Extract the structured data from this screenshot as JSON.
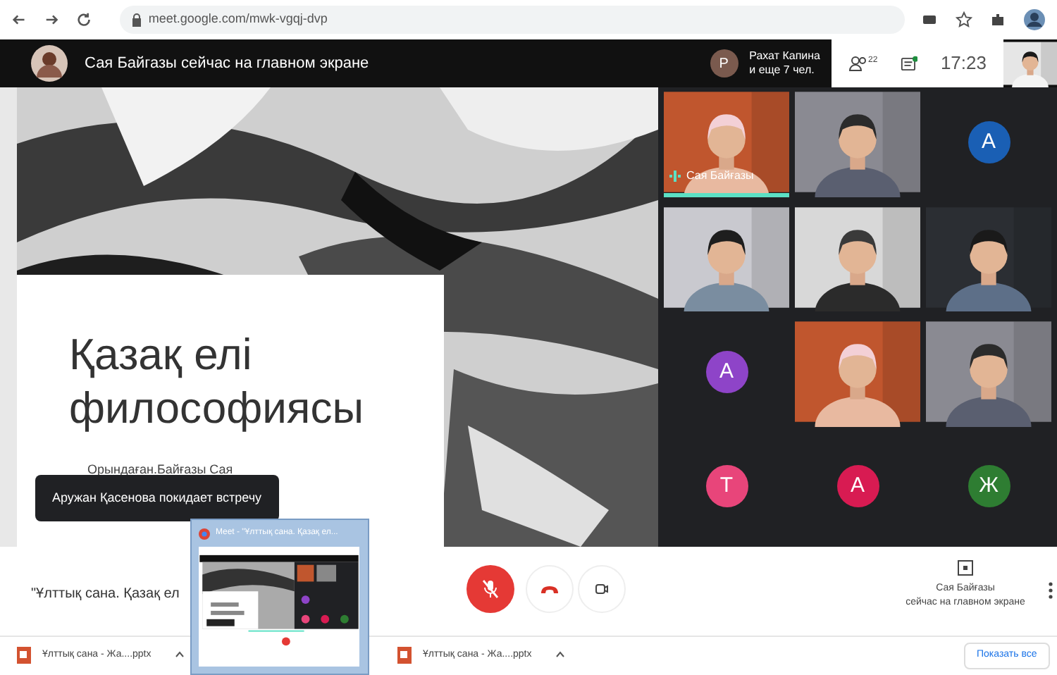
{
  "browser": {
    "url": "meet.google.com/mwk-vgqj-dvp"
  },
  "header": {
    "presenter_notice": "Сая Байгазы сейчас на главном экране",
    "participant_initial": "P",
    "participant_name": "Рахат Капина",
    "others": "и еще 7 чел.",
    "people_count": "22",
    "chat_unread": true,
    "time": "17:23"
  },
  "slide": {
    "title": "Қазақ елі философиясы",
    "author": "Орындаған.Байғазы Сая"
  },
  "toast": "Аружан Қасенова покидает встречу",
  "tiles": [
    {
      "kind": "video",
      "speaking": true,
      "label": "Сая Байғазы"
    },
    {
      "kind": "video",
      "speaking": false
    },
    {
      "kind": "avatar",
      "letter": "A",
      "color": "#1a5fb4"
    },
    {
      "kind": "video",
      "speaking": false
    },
    {
      "kind": "video",
      "speaking": false
    },
    {
      "kind": "video",
      "speaking": false
    },
    {
      "kind": "avatar",
      "letter": "A",
      "color": "#8e44c8"
    },
    {
      "kind": "video",
      "speaking": false
    },
    {
      "kind": "video",
      "speaking": false
    },
    {
      "kind": "avatar",
      "letter": "T",
      "color": "#e8457a"
    },
    {
      "kind": "avatar",
      "letter": "A",
      "color": "#d81b52"
    },
    {
      "kind": "avatar",
      "letter": "Ж",
      "color": "#2e7d32"
    }
  ],
  "controls": {
    "meeting_title": "\"Ұлттық сана. Қазақ ел",
    "mic_muted": true,
    "presenting_name": "Сая Байғазы",
    "presenting_note": "сейчас на главном экране"
  },
  "preview": {
    "title": "Meet - \"Ұлттық сана. Қазақ ел..."
  },
  "downloads": {
    "items": [
      "Ұлттық сана - Жа....pptx",
      "Ұлттық сана - Жа....pptx"
    ],
    "show_all": "Показать все"
  }
}
